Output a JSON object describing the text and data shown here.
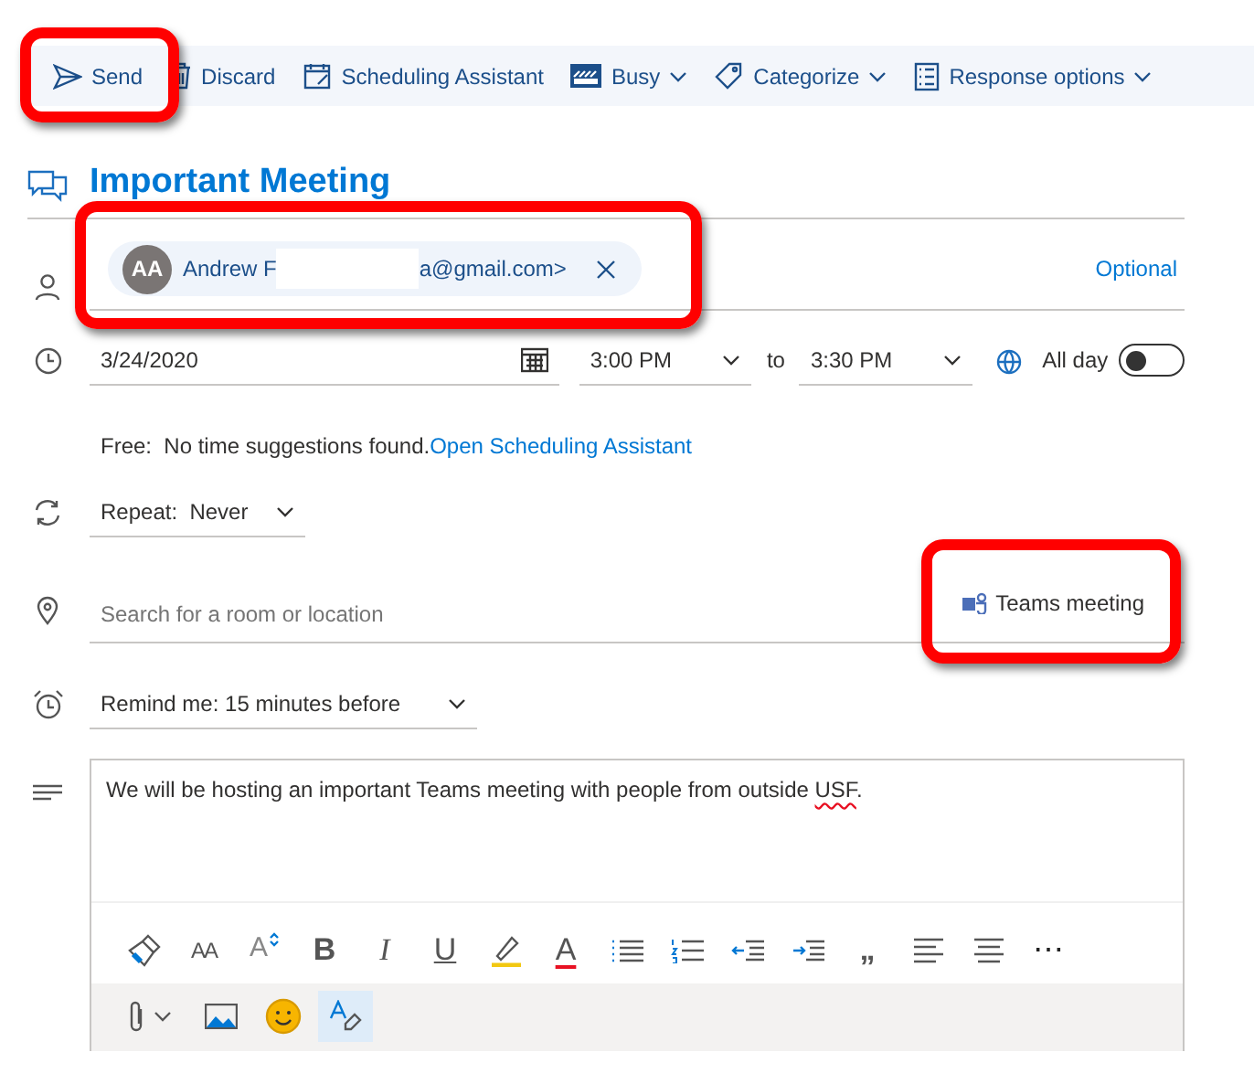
{
  "toolbar": [
    {
      "kind": "send",
      "label": "Send",
      "dropdown": false,
      "highlighted": true
    },
    {
      "kind": "trash",
      "label": "Discard",
      "dropdown": false,
      "highlighted": false
    },
    {
      "kind": "calendar",
      "label": "Scheduling Assistant",
      "dropdown": false,
      "highlighted": false
    },
    {
      "kind": "busy",
      "label": "Busy",
      "dropdown": true,
      "highlighted": false
    },
    {
      "kind": "tag",
      "label": "Categorize",
      "dropdown": true,
      "highlighted": false
    },
    {
      "kind": "list",
      "label": "Response options",
      "dropdown": true,
      "highlighted": false
    }
  ],
  "title": "Important Meeting",
  "attendees": {
    "highlighted": true,
    "recipients": [
      {
        "initials": "AA",
        "name": "Andrew F",
        "address": "a@gmail.com>",
        "redacted": true
      }
    ],
    "optional_link": "Optional"
  },
  "when": {
    "date": "3/24/2020",
    "start": "3:00 PM",
    "separator": "to",
    "end": "3:30 PM",
    "all_day_label": "All day",
    "all_day": false
  },
  "suggestion": {
    "label": "Free:",
    "text": "No time suggestions found.",
    "link": "Open Scheduling Assistant"
  },
  "repeat": "Repeat:  Never",
  "location": {
    "placeholder": "Search for a room or location",
    "teams_label": "Teams meeting",
    "highlighted": true
  },
  "reminder": "Remind me: 15 minutes before",
  "body": {
    "before": "We will be hosting an important Teams meeting with people from outside ",
    "misspelled": "USF",
    "after": "."
  },
  "format_tools": [
    {
      "kind": "painter"
    },
    {
      "kind": "fontsize",
      "glyph": "AA"
    },
    {
      "kind": "grow",
      "glyph": "A"
    },
    {
      "kind": "bold",
      "glyph": "B"
    },
    {
      "kind": "italic",
      "glyph": "I"
    },
    {
      "kind": "underline",
      "glyph": "U"
    },
    {
      "kind": "highlight"
    },
    {
      "kind": "fontcolor",
      "glyph": "A"
    },
    {
      "kind": "bullets"
    },
    {
      "kind": "numbers"
    },
    {
      "kind": "outdent"
    },
    {
      "kind": "indent"
    },
    {
      "kind": "quote",
      "glyph": "„"
    },
    {
      "kind": "alignleft"
    },
    {
      "kind": "center"
    },
    {
      "kind": "more",
      "glyph": "⋯"
    }
  ],
  "insert_tools": [
    {
      "kind": "attach",
      "selected": false
    },
    {
      "kind": "image",
      "selected": false
    },
    {
      "kind": "emoji",
      "selected": false
    },
    {
      "kind": "clearformat",
      "selected": true
    }
  ]
}
